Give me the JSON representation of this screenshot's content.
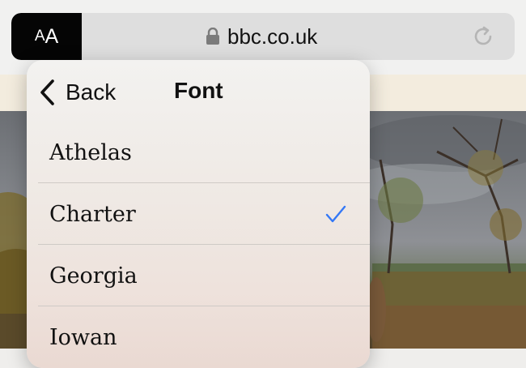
{
  "toolbar": {
    "reader_button_label_small": "A",
    "reader_button_label_large": "A",
    "url": "bbc.co.uk",
    "lock_icon": "lock-icon",
    "reload_icon": "reload-icon"
  },
  "popover": {
    "back_label": "Back",
    "title": "Font",
    "fonts": [
      {
        "label": "Athelas",
        "selected": false
      },
      {
        "label": "Charter",
        "selected": true
      },
      {
        "label": "Georgia",
        "selected": false
      },
      {
        "label": "Iowan",
        "selected": false
      }
    ]
  },
  "colors": {
    "accent": "#3478f6",
    "reader_button_bg": "#050505"
  }
}
